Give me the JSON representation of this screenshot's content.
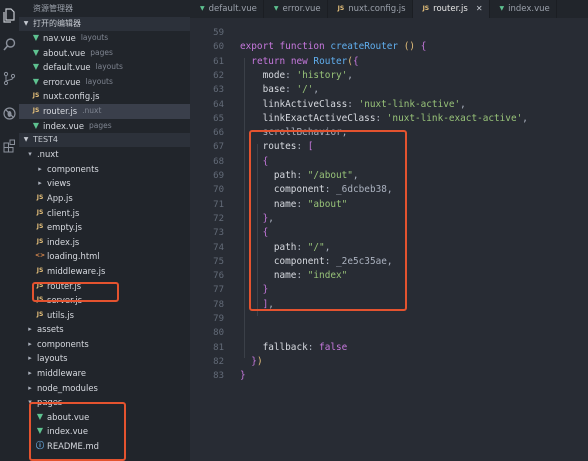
{
  "sidebar": {
    "title": "资源管理器",
    "open_editors": {
      "label": "打开的编辑器",
      "items": [
        {
          "name": "nav.vue",
          "folder": "layouts",
          "type": "vue"
        },
        {
          "name": "about.vue",
          "folder": "pages",
          "type": "vue"
        },
        {
          "name": "default.vue",
          "folder": "layouts",
          "type": "vue"
        },
        {
          "name": "error.vue",
          "folder": "layouts",
          "type": "vue"
        },
        {
          "name": "nuxt.config.js",
          "folder": "",
          "type": "js"
        },
        {
          "name": "router.js",
          "folder": ".nuxt",
          "type": "js"
        },
        {
          "name": "index.vue",
          "folder": "pages",
          "type": "vue"
        }
      ]
    },
    "workspace": {
      "label": "TEST4",
      "tree": [
        {
          "name": ".nuxt",
          "type": "folder-open"
        },
        {
          "name": "components",
          "type": "folder"
        },
        {
          "name": "views",
          "type": "folder"
        },
        {
          "name": "App.js",
          "type": "js"
        },
        {
          "name": "client.js",
          "type": "js"
        },
        {
          "name": "empty.js",
          "type": "js"
        },
        {
          "name": "index.js",
          "type": "js"
        },
        {
          "name": "loading.html",
          "type": "html"
        },
        {
          "name": "middleware.js",
          "type": "js"
        },
        {
          "name": "router.js",
          "type": "js"
        },
        {
          "name": "server.js",
          "type": "js"
        },
        {
          "name": "utils.js",
          "type": "js"
        },
        {
          "name": "assets",
          "type": "folder"
        },
        {
          "name": "components",
          "type": "folder"
        },
        {
          "name": "layouts",
          "type": "folder"
        },
        {
          "name": "middleware",
          "type": "folder"
        },
        {
          "name": "node_modules",
          "type": "folder"
        },
        {
          "name": "pages",
          "type": "folder-open"
        },
        {
          "name": "about.vue",
          "type": "vue"
        },
        {
          "name": "index.vue",
          "type": "vue"
        },
        {
          "name": "README.md",
          "type": "info"
        }
      ]
    }
  },
  "tabs": [
    {
      "label": "default.vue",
      "type": "vue",
      "active": false
    },
    {
      "label": "error.vue",
      "type": "vue",
      "active": false
    },
    {
      "label": "nuxt.config.js",
      "type": "js",
      "active": false
    },
    {
      "label": "router.js",
      "type": "js",
      "active": true
    },
    {
      "label": "index.vue",
      "type": "vue",
      "active": false
    }
  ],
  "icons": {
    "files": "files-icon",
    "search": "search-icon",
    "source_control": "source-control-icon",
    "debug": "debug-icon",
    "extensions": "extensions-icon",
    "close": "close-icon"
  },
  "editor": {
    "line_numbers": [
      "59",
      "60",
      "61",
      "62",
      "63",
      "64",
      "65",
      "66",
      "67",
      "68",
      "69",
      "70",
      "71",
      "72",
      "73",
      "74",
      "75",
      "76",
      "77",
      "78",
      "79",
      "80",
      "81",
      "82",
      "83"
    ],
    "lines": [
      "",
      "export function createRouter () {",
      "  return new Router({",
      "    mode: 'history',",
      "    base: '/',",
      "    linkActiveClass: 'nuxt-link-active',",
      "    linkExactActiveClass: 'nuxt-link-exact-active',",
      "    scrollBehavior,",
      "    routes: [",
      "    {",
      "      path: \"/about\",",
      "      component: _6dcbeb38,",
      "      name: \"about\"",
      "    },",
      "    {",
      "      path: \"/\",",
      "      component: _2e5c35ae,",
      "      name: \"index\"",
      "    }",
      "    ],",
      "",
      "",
      "    fallback: false",
      "  })",
      "}"
    ]
  },
  "colors": {
    "highlight_box": "#e4532f",
    "editor_bg": "#282c34",
    "sidebar_bg": "#21252b"
  }
}
